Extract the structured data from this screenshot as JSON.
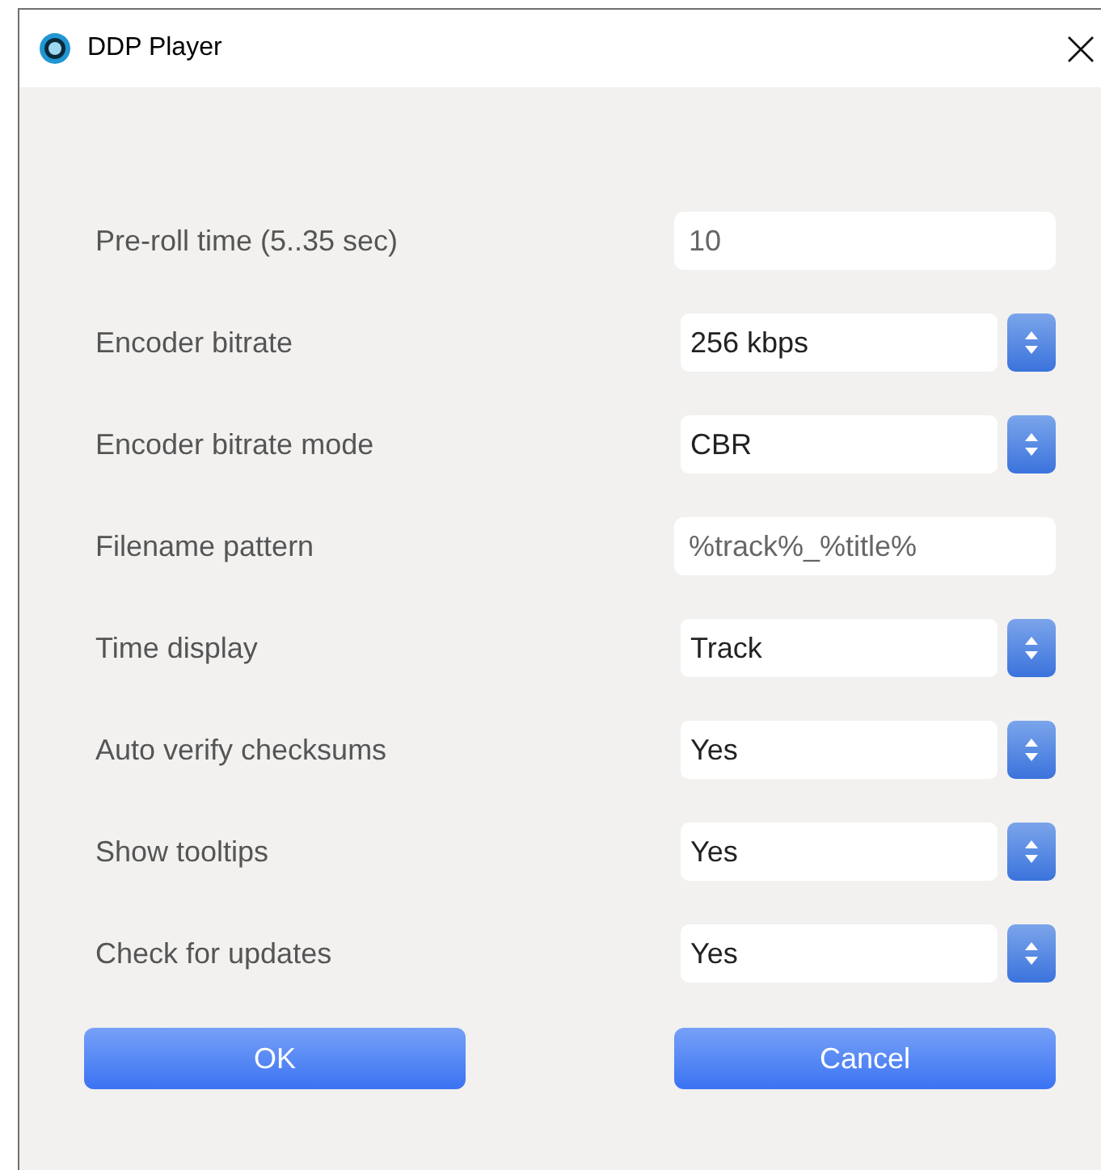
{
  "window": {
    "title": "DDP Player"
  },
  "settings": [
    {
      "label": "Pre-roll time (5..35 sec)",
      "kind": "text",
      "value": "10"
    },
    {
      "label": "Encoder bitrate",
      "kind": "select",
      "value": "256 kbps"
    },
    {
      "label": "Encoder bitrate mode",
      "kind": "select",
      "value": "CBR"
    },
    {
      "label": "Filename pattern",
      "kind": "text",
      "value": "%track%_%title%"
    },
    {
      "label": "Time display",
      "kind": "select",
      "value": "Track"
    },
    {
      "label": "Auto verify checksums",
      "kind": "select",
      "value": "Yes"
    },
    {
      "label": "Show tooltips",
      "kind": "select",
      "value": "Yes"
    },
    {
      "label": "Check for updates",
      "kind": "select",
      "value": "Yes"
    }
  ],
  "buttons": [
    "OK",
    "Cancel"
  ]
}
